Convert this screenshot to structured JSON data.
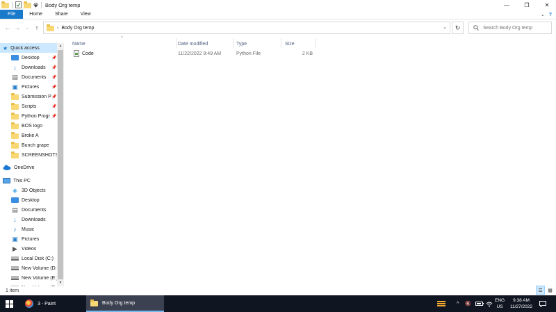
{
  "window": {
    "title": "Body Org temp",
    "controls": {
      "minimize": "—",
      "maximize": "❐",
      "close": "✕"
    }
  },
  "ribbon": {
    "tabs": [
      {
        "label": "File"
      },
      {
        "label": "Home"
      },
      {
        "label": "Share"
      },
      {
        "label": "View"
      }
    ],
    "expand_glyph": "⌄",
    "help_glyph": "?"
  },
  "address": {
    "separator": "›",
    "path": "Body Org temp",
    "search_placeholder": "Search Body Org temp"
  },
  "nav": {
    "quick_access": "Quick access",
    "items": [
      {
        "label": "Desktop",
        "icon": "bluebox",
        "pinned": true
      },
      {
        "label": "Downloads",
        "icon": "download",
        "pinned": true
      },
      {
        "label": "Documents",
        "icon": "doc",
        "pinned": true
      },
      {
        "label": "Pictures",
        "icon": "pic",
        "pinned": true
      },
      {
        "label": "Submission P",
        "icon": "folder",
        "pinned": true
      },
      {
        "label": "Scripts",
        "icon": "folder",
        "pinned": true
      },
      {
        "label": "Python Progr",
        "icon": "folder",
        "pinned": true
      },
      {
        "label": "BOS logo",
        "icon": "folder",
        "pinned": false
      },
      {
        "label": "Broke A",
        "icon": "folder",
        "pinned": false
      },
      {
        "label": "Bunch grape",
        "icon": "folder",
        "pinned": false
      },
      {
        "label": "SCREENSHOTS",
        "icon": "folder",
        "pinned": false
      }
    ],
    "onedrive": "OneDrive",
    "this_pc": "This PC",
    "pc_items": [
      {
        "label": "3D Objects",
        "icon": "cube"
      },
      {
        "label": "Desktop",
        "icon": "bluebox"
      },
      {
        "label": "Documents",
        "icon": "doc"
      },
      {
        "label": "Downloads",
        "icon": "download"
      },
      {
        "label": "Music",
        "icon": "music"
      },
      {
        "label": "Pictures",
        "icon": "pic"
      },
      {
        "label": "Videos",
        "icon": "video"
      },
      {
        "label": "Local Disk (C:)",
        "icon": "drive"
      },
      {
        "label": "New Volume (D:",
        "icon": "drive"
      },
      {
        "label": "New Volume (E:)",
        "icon": "drive"
      },
      {
        "label": "New Volume (F:",
        "icon": "drive"
      }
    ]
  },
  "columns": {
    "name": "Name",
    "date": "Date modified",
    "type": "Type",
    "size": "Size"
  },
  "files": [
    {
      "name": "Code",
      "date": "11/22/2022 9:49 AM",
      "type": "Python File",
      "size": "2 KB"
    }
  ],
  "status": {
    "count": "1 item"
  },
  "taskbar": {
    "tasks": [
      {
        "label": "3 - Paint"
      },
      {
        "label": "Body Org temp"
      }
    ],
    "lang_top": "ENG",
    "lang_bottom": "US",
    "time": "9:38 AM",
    "date": "11/27/2022"
  }
}
